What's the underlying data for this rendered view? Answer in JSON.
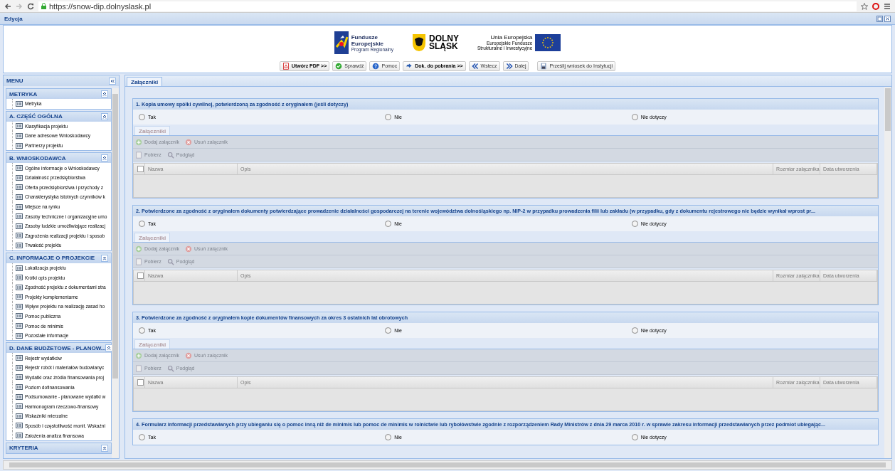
{
  "browser": {
    "url": "https://snow-dip.dolnyslask.pl"
  },
  "window": {
    "title": "Edycja"
  },
  "logos": {
    "fe": [
      "Fundusze",
      "Europejskie",
      "Program Regionalny"
    ],
    "ds": [
      "DOLNY",
      "ŚLĄSK"
    ],
    "ue": [
      "Unia Europejska",
      "Europejskie Fundusze",
      "Strukturalne i Inwestycyjne"
    ]
  },
  "toolbar": [
    {
      "label": "Utwórz PDF >>",
      "kind": "pdf",
      "bold": true
    },
    {
      "label": "Sprawdź",
      "kind": "check",
      "bold": false
    },
    {
      "label": "Pomoc",
      "kind": "help",
      "bold": false
    },
    {
      "label": "Dok. do pobrania >>",
      "kind": "download",
      "bold": true
    },
    {
      "label": "Wstecz",
      "kind": "back",
      "bold": false
    },
    {
      "label": "Dalej",
      "kind": "next",
      "bold": false
    },
    {
      "label": "Prześlij wniosek do Instytucji",
      "kind": "send",
      "bold": false
    }
  ],
  "menu": {
    "title": "MENU",
    "groups": [
      {
        "title": "METRYKA",
        "items": [
          "Metryka"
        ]
      },
      {
        "title": "A. CZĘŚĆ OGÓLNA",
        "items": [
          "Klasyfikacja projektu",
          "Dane adresowe Wnioskodawcy",
          "Partnerzy projektu"
        ]
      },
      {
        "title": "B. WNIOSKODAWCA",
        "items": [
          "Ogólne informacje o Wnioskodawcy",
          "Działalność przedsiębiorstwa",
          "Oferta przedsiębiorstwa i przychody z",
          "Charakterystyka istotnych czynników k",
          "Miejsce na rynku",
          "Zasoby techniczne i organizacyjne umo",
          "Zasoby ludzkie umożliwiające realizacj",
          "Zagrożenia realizacji projektu i sposob",
          "Trwałość projektu"
        ]
      },
      {
        "title": "C. INFORMACJE O PROJEKCIE",
        "items": [
          "Lokalizacja projektu",
          "Krótki opis projektu",
          "Zgodność projektu z dokumentami stra",
          "Projekty komplementarne",
          "Wpływ projektu na realizację zasad ho",
          "Pomoc publiczna",
          "Pomoc de minimis",
          "Pozostałe informacje"
        ]
      },
      {
        "title": "D. DANE BUDŻETOWE - PLANOW...",
        "items": [
          "Rejestr wydatków",
          "Rejestr robót i materiałów budowlanyc",
          "Wydatki oraz źródła finansowania proj",
          "Poziom dofinansowania",
          "Podsumowanie - planowane wydatki w",
          "Harmonogram rzeczowo-finansowy",
          "Wskaźniki mierzalne",
          "Sposób i częstotliwość monit. Wskaźni",
          "Założenia analiza finansowa"
        ]
      },
      {
        "title": "KRYTERIA"
      }
    ]
  },
  "tabs": [
    {
      "label": "Załączniki",
      "selected": true
    }
  ],
  "sections": [
    {
      "title": "1. Kopia umowy spółki cywilnej, potwierdzoną za zgodność z oryginałem (jeśli dotyczy)",
      "options": [
        {
          "label": "Tak",
          "selected": false
        },
        {
          "label": "Nie",
          "selected": false
        },
        {
          "label": "Nie dotyczy",
          "selected": false
        }
      ],
      "attachments": {
        "tab": "Załączniki",
        "actions": [
          {
            "label": "Dodaj załącznik",
            "kind": "add",
            "disabled": true
          },
          {
            "label": "Usuń załącznik",
            "kind": "remove",
            "disabled": true
          }
        ],
        "actions2": [
          {
            "label": "Pobierz",
            "kind": "download",
            "disabled": true
          },
          {
            "label": "Podgląd",
            "kind": "preview",
            "disabled": true
          }
        ],
        "columns": [
          "Nazwa",
          "Opis",
          "Rozmiar załącznika",
          "Data utworzenia"
        ],
        "select_all_checked": false
      }
    },
    {
      "title": "2. Potwierdzone za zgodność z oryginałem dokumenty potwierdzające prowadzenie działalności gospodarczej na terenie województwa dolnośląskiego np. NIP-2 w przypadku prowadzenia filii lub zakładu (w przypadku, gdy z dokumentu rejestrowego nie będzie wynikał wprost pr...",
      "options": [
        {
          "label": "Tak",
          "selected": false
        },
        {
          "label": "Nie",
          "selected": false
        },
        {
          "label": "Nie dotyczy",
          "selected": false
        }
      ],
      "attachments": {
        "tab": "Załączniki",
        "actions": [
          {
            "label": "Dodaj załącznik",
            "kind": "add",
            "disabled": true
          },
          {
            "label": "Usuń załącznik",
            "kind": "remove",
            "disabled": true
          }
        ],
        "actions2": [
          {
            "label": "Pobierz",
            "kind": "download",
            "disabled": true
          },
          {
            "label": "Podgląd",
            "kind": "preview",
            "disabled": true
          }
        ],
        "columns": [
          "Nazwa",
          "Opis",
          "Rozmiar załącznika",
          "Data utworzenia"
        ],
        "select_all_checked": false
      }
    },
    {
      "title": "3. Potwierdzone za zgodność z oryginałem kopie dokumentów finansowych za okres 3 ostatnich lat obrotowych",
      "options": [
        {
          "label": "Tak",
          "selected": false
        },
        {
          "label": "Nie",
          "selected": false
        },
        {
          "label": "Nie dotyczy",
          "selected": false
        }
      ],
      "attachments": {
        "tab": "Załączniki",
        "actions": [
          {
            "label": "Dodaj załącznik",
            "kind": "add",
            "disabled": true
          },
          {
            "label": "Usuń załącznik",
            "kind": "remove",
            "disabled": true
          }
        ],
        "actions2": [
          {
            "label": "Pobierz",
            "kind": "download",
            "disabled": true
          },
          {
            "label": "Podgląd",
            "kind": "preview",
            "disabled": true
          }
        ],
        "columns": [
          "Nazwa",
          "Opis",
          "Rozmiar załącznika",
          "Data utworzenia"
        ],
        "select_all_checked": false
      }
    },
    {
      "title": "4. Formularz informacji przedstawianych przy ubieganiu się o pomoc inną niż de minimis lub pomoc de minimis w rolnictwie lub rybołówstwie zgodnie z rozporządzeniem Rady Ministrów z dnia 29 marca 2010 r. w sprawie zakresu informacji przedstawianych przez podmiot ubiegając...",
      "options": [
        {
          "label": "Tak",
          "selected": false
        },
        {
          "label": "Nie",
          "selected": false
        },
        {
          "label": "Nie dotyczy",
          "selected": false
        }
      ]
    }
  ]
}
